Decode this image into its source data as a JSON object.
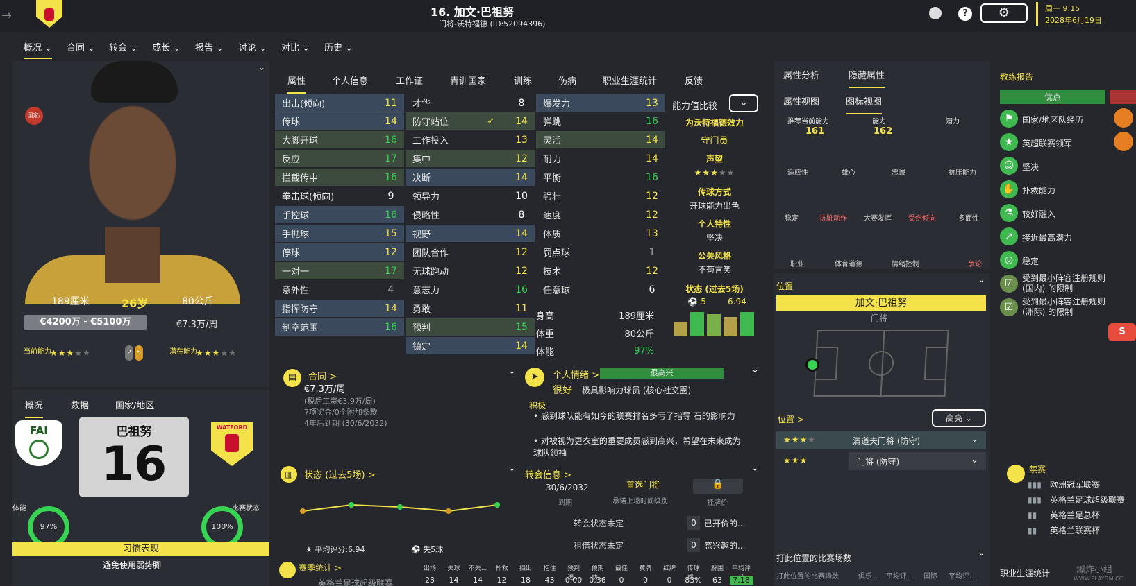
{
  "header": {
    "title": "16. 加文·巴祖努",
    "subtitle": "门将-沃特福德 (ID:52094396)",
    "weekday_time": "周一 9:15",
    "date": "2028年6月19日",
    "help": "?"
  },
  "nav": [
    "概况",
    "合同",
    "转会",
    "成长",
    "报告",
    "讨论",
    "对比",
    "历史"
  ],
  "profile": {
    "height": "189厘米",
    "age": "26岁",
    "weight": "80公斤",
    "value": "€4200万 - €5100万",
    "wage": "€7.3万/周",
    "current_ability_label": "当前能力",
    "potential_label": "潜在能力",
    "badge_a": "2",
    "badge_b": "5",
    "flag_label": "国家/"
  },
  "subtabs": [
    "概况",
    "数据",
    "国家/地区"
  ],
  "shirt": {
    "name": "巴祖努",
    "number": "16",
    "fai": "FAI",
    "club": "WATFORD"
  },
  "fitness": {
    "label": "体能",
    "value": "97%"
  },
  "condition": {
    "label": "比赛状态",
    "value": "100%"
  },
  "habits": {
    "title": "习惯表现",
    "item": "避免使用弱势脚"
  },
  "attr_tabs": [
    "属性",
    "个人信息",
    "工作证",
    "青训国家",
    "训练",
    "伤病",
    "职业生涯统计",
    "反馈"
  ],
  "gk_attrs": [
    [
      "出击(倾向)",
      "11"
    ],
    [
      "传球",
      "14"
    ],
    [
      "大脚开球",
      "16"
    ],
    [
      "反应",
      "17"
    ],
    [
      "拦截传中",
      "16"
    ],
    [
      "拳击球(倾向)",
      "9"
    ],
    [
      "手控球",
      "16"
    ],
    [
      "手抛球",
      "15"
    ],
    [
      "停球",
      "12"
    ],
    [
      "一对一",
      "17"
    ],
    [
      "意外性",
      "4"
    ],
    [
      "指挥防守",
      "14"
    ],
    [
      "制空范围",
      "16"
    ]
  ],
  "mental_attrs": [
    [
      "才华",
      "8"
    ],
    [
      "防守站位",
      "14"
    ],
    [
      "工作投入",
      "13"
    ],
    [
      "集中",
      "12"
    ],
    [
      "决断",
      "14"
    ],
    [
      "领导力",
      "10"
    ],
    [
      "侵略性",
      "8"
    ],
    [
      "视野",
      "14"
    ],
    [
      "团队合作",
      "12"
    ],
    [
      "无球跑动",
      "12"
    ],
    [
      "意志力",
      "16"
    ],
    [
      "勇敢",
      "11"
    ],
    [
      "预判",
      "15"
    ],
    [
      "镇定",
      "14"
    ]
  ],
  "physical_attrs": [
    [
      "爆发力",
      "13"
    ],
    [
      "弹跳",
      "16"
    ],
    [
      "灵活",
      "14"
    ],
    [
      "耐力",
      "14"
    ],
    [
      "平衡",
      "16"
    ],
    [
      "强壮",
      "12"
    ],
    [
      "速度",
      "12"
    ],
    [
      "体质",
      "13"
    ],
    [
      "罚点球",
      "1"
    ],
    [
      "技术",
      "12"
    ],
    [
      "任意球",
      "6"
    ]
  ],
  "body": [
    [
      "身高",
      "189厘米"
    ],
    [
      "体重",
      "80公斤"
    ],
    [
      "体能",
      "97%"
    ]
  ],
  "compare": {
    "label": "能力值比较",
    "for_club": "为沃特福德效力",
    "role": "守门员",
    "rep_label": "声望",
    "pass_label": "传球方式",
    "pass_value": "开球能力出色",
    "trait_label": "个人特性",
    "trait_value": "坚决",
    "pr_label": "公关风格",
    "pr_value": "不苟言笑",
    "form_label": "状态 (过去5场)",
    "form_goals": "-5",
    "form_rating": "6.94",
    "bars": [
      0.55,
      0.95,
      0.85,
      0.75,
      0.95
    ]
  },
  "contract": {
    "title": "合同 >",
    "wage": "€7.3万/周",
    "pre_tax": "(税后工资€3.9万/周)",
    "bonus": "7项奖金/0个附加条款",
    "expiry": "4年后到期 (30/6/2032)"
  },
  "mood": {
    "title": "个人情绪 >",
    "level": "很高兴",
    "state": "很好",
    "influence": "极具影响力球员 (核心社交圈)",
    "positive": "积极",
    "items": [
      "感到球队能有如今的联赛排名多亏了指导 石的影响力",
      "对被视为更衣室的重要成员感到高兴，希望在未来成为球队领袖"
    ]
  },
  "form": {
    "title": "状态 (过去5场) >",
    "avg": "平均评分:6.94",
    "conceded": "失5球"
  },
  "chart_data": {
    "type": "line",
    "categories": [
      "1",
      "2",
      "3",
      "4",
      "5"
    ],
    "values": [
      6.8,
      7.1,
      7.0,
      6.8,
      7.1
    ],
    "ylim": [
      6,
      8
    ]
  },
  "transfer": {
    "title": "转会信息 >",
    "date": "30/6/2032",
    "date_label": "到期",
    "pref": "首选门将",
    "pref_label": "承诺上场时间级别",
    "price_label": "挂牌价",
    "status": "转会状态未定",
    "loan": "租借状态未定",
    "offers": "已开价的...",
    "interest": "感兴趣的...",
    "zero": "0"
  },
  "season": {
    "title": "赛季统计 >",
    "comp": "英格兰足球超级联赛",
    "cols": [
      "出场",
      "失球",
      "不失...",
      "扑救",
      "挡出",
      "抱住",
      "预判进...",
      "预期助...",
      "最佳",
      "黄牌",
      "红牌",
      "传球成...",
      "解围",
      "平均评分"
    ],
    "vals": [
      "23",
      "14",
      "14",
      "12",
      "18",
      "43",
      "0.00",
      "0.36",
      "0",
      "0",
      "0",
      "83%",
      "63",
      "7.18"
    ]
  },
  "analysis": {
    "tabs": [
      "属性分析",
      "隐藏属性"
    ],
    "views": [
      "属性视图",
      "图标视图"
    ],
    "cols": [
      "推荐当前能力",
      "能力",
      "潜力"
    ],
    "ca": "161",
    "pa": "162",
    "row1": [
      "适应性",
      "雄心",
      "忠诚",
      "抗压能力"
    ],
    "row2": [
      "稳定",
      "抗脏动作",
      "大赛发挥",
      "受伤倾向",
      "多面性"
    ],
    "row3": [
      "职业",
      "体育道德",
      "情绪控制",
      "争论"
    ]
  },
  "position": {
    "title": "位置",
    "name": "加文·巴祖努",
    "role": "门将",
    "roles_label": "位置 >",
    "highlight": "高亮",
    "role1": "清道夫门将 (防守)",
    "role2": "门将 (防守)",
    "matches_title": "打此位置的比赛场数",
    "matches_col": "打此位置的比赛场数",
    "club_col": "俱乐...",
    "avg_col": "平均评...",
    "intl_col": "国际",
    "avg2_col": "平均评..."
  },
  "coach": {
    "title": "教练报告",
    "strengths": "优点",
    "items": [
      "国家/地区队经历",
      "英超联赛领军",
      "坚决",
      "扑救能力",
      "较好融入",
      "接近最高潜力",
      "稳定",
      "受到最小阵容注册规则 (国内) 的限制",
      "受到最小阵容注册规则 (洲际) 的限制"
    ]
  },
  "bans": {
    "title": "禁赛",
    "items": [
      "欧洲冠军联赛",
      "英格兰足球超级联赛",
      "英格兰足总杯",
      "英格兰联赛杯"
    ]
  },
  "career": {
    "title": "职业生涯统计"
  },
  "watermark": {
    "cn": "爆炸小组",
    "en": "WWW.PLAYGM.CC"
  },
  "colors": {
    "accent": "#f3e24a",
    "green": "#39d353",
    "panel": "#2a2d33"
  }
}
